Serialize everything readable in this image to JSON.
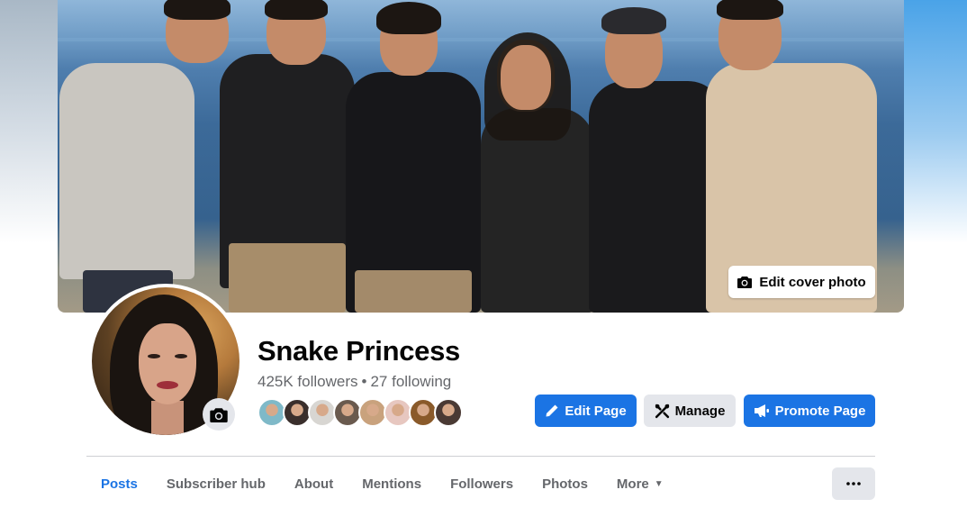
{
  "cover": {
    "edit_label": "Edit cover photo"
  },
  "profile": {
    "name": "Snake Princess",
    "followers": "425K followers",
    "separator": "•",
    "following": "27 following",
    "follower_face_colors": [
      "#7fb9c8",
      "#3a2f2c",
      "#d8d6d2",
      "#6a5a4e",
      "#c9a27d",
      "#e7c7c0",
      "#8a5a2a",
      "#4a3a34"
    ]
  },
  "actions": {
    "edit_page": "Edit Page",
    "manage": "Manage",
    "promote_page": "Promote Page"
  },
  "tabs": [
    {
      "label": "Posts",
      "active": true
    },
    {
      "label": "Subscriber hub",
      "active": false
    },
    {
      "label": "About",
      "active": false
    },
    {
      "label": "Mentions",
      "active": false
    },
    {
      "label": "Followers",
      "active": false
    },
    {
      "label": "Photos",
      "active": false
    },
    {
      "label": "More",
      "active": false
    }
  ],
  "colors": {
    "accent": "#1b74e4",
    "secondary_button": "#e4e6eb",
    "muted_text": "#65676b"
  }
}
